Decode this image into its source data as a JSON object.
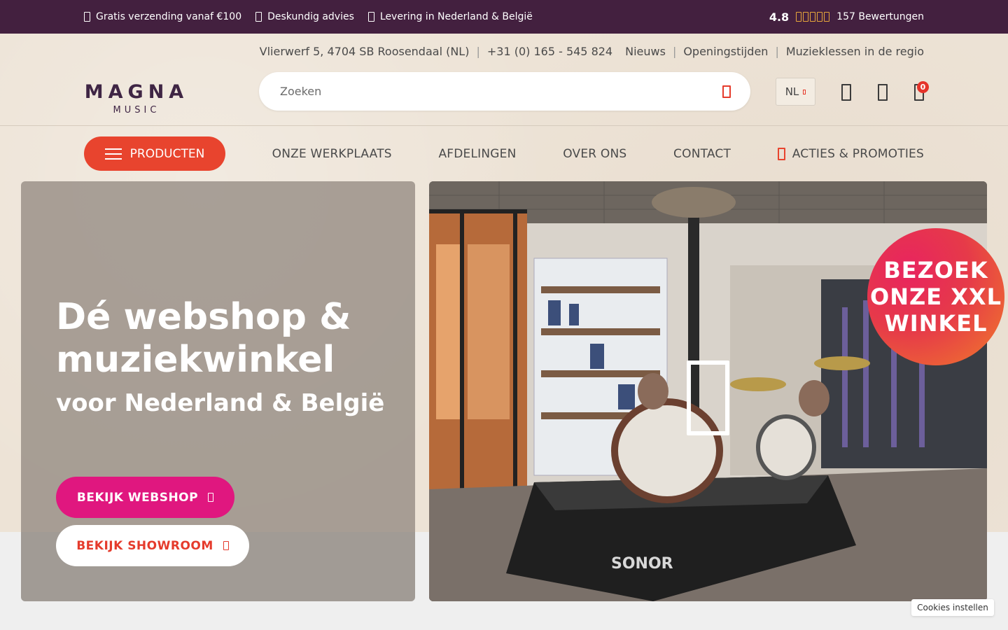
{
  "topbar": {
    "usps": [
      {
        "label": "Gratis verzending vanaf €100",
        "icon": "truck-icon"
      },
      {
        "label": "Deskundig advies",
        "icon": "chat-icon"
      },
      {
        "label": "Levering in Nederland & België",
        "icon": "location-icon"
      }
    ],
    "rating": {
      "score": "4.8",
      "stars": 5,
      "reviews": "157 Bewertungen"
    }
  },
  "logo": {
    "word": "MAGNA",
    "sub": "MUSIC"
  },
  "header": {
    "address": "Vlierwerf 5, 4704 SB Roosendaal (NL)",
    "phone": "+31 (0) 165 - 545 824",
    "links": [
      "Nieuws",
      "Openingstijden",
      "Muzieklessen in de regio"
    ],
    "search_placeholder": "Zoeken",
    "language": "NL",
    "cart_count": "0"
  },
  "nav": {
    "products": "PRODUCTEN",
    "items": [
      "ONZE WERKPLAATS",
      "AFDELINGEN",
      "OVER ONS",
      "CONTACT"
    ],
    "promo": "ACTIES & PROMOTIES"
  },
  "hero": {
    "title": "Dé webshop & muziekwinkel",
    "subtitle": "voor Nederland & België",
    "btn_webshop": "BEKIJK WEBSHOP",
    "btn_showroom": "BEKIJK SHOWROOM",
    "badge": "BEZOEK ONZE XXL WINKEL"
  },
  "cookies": "Cookies instellen",
  "colors": {
    "topbar": "#43203f",
    "accent_red": "#e8442e",
    "accent_pink": "#e0177f",
    "star": "#e7a73b"
  }
}
